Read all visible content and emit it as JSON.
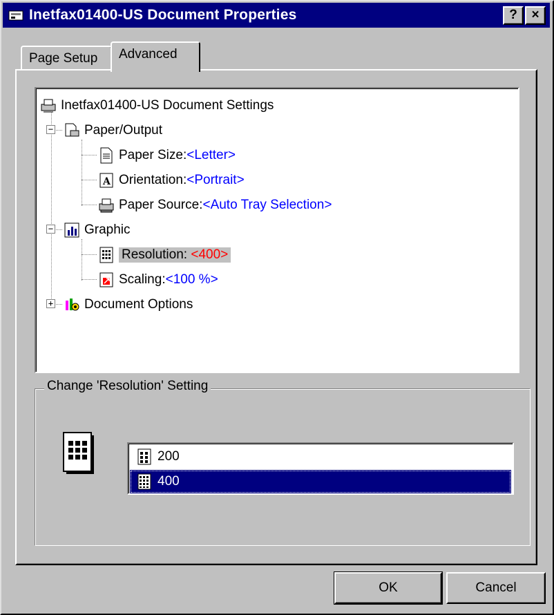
{
  "window": {
    "title": "Inetfax01400-US Document Properties",
    "help_label": "?",
    "close_label": "×"
  },
  "tabs": [
    {
      "label": "Page Setup",
      "active": false
    },
    {
      "label": "Advanced",
      "active": true
    }
  ],
  "tree": {
    "root": "Inetfax01400-US Document Settings",
    "paper_output": "Paper/Output",
    "paper_size_label": "Paper Size: ",
    "paper_size_value": "<Letter>",
    "orientation_label": "Orientation: ",
    "orientation_value": "<Portrait>",
    "paper_source_label": "Paper Source: ",
    "paper_source_value": "<Auto Tray Selection>",
    "graphic": "Graphic",
    "resolution_label": "Resolution: ",
    "resolution_value": "<400>",
    "scaling_label": "Scaling: ",
    "scaling_value": "<100 %>",
    "document_options": "Document Options",
    "expand_minus": "−",
    "expand_plus": "+"
  },
  "change_setting": {
    "label": "Change 'Resolution' Setting",
    "options": [
      {
        "label": "200",
        "selected": false
      },
      {
        "label": "400",
        "selected": true
      }
    ]
  },
  "buttons": {
    "ok": "OK",
    "cancel": "Cancel"
  },
  "colors": {
    "title_bar": "#000080",
    "value_link": "#0000ff",
    "value_changed": "#ff0000",
    "selection": "#000080",
    "face": "#c0c0c0"
  }
}
